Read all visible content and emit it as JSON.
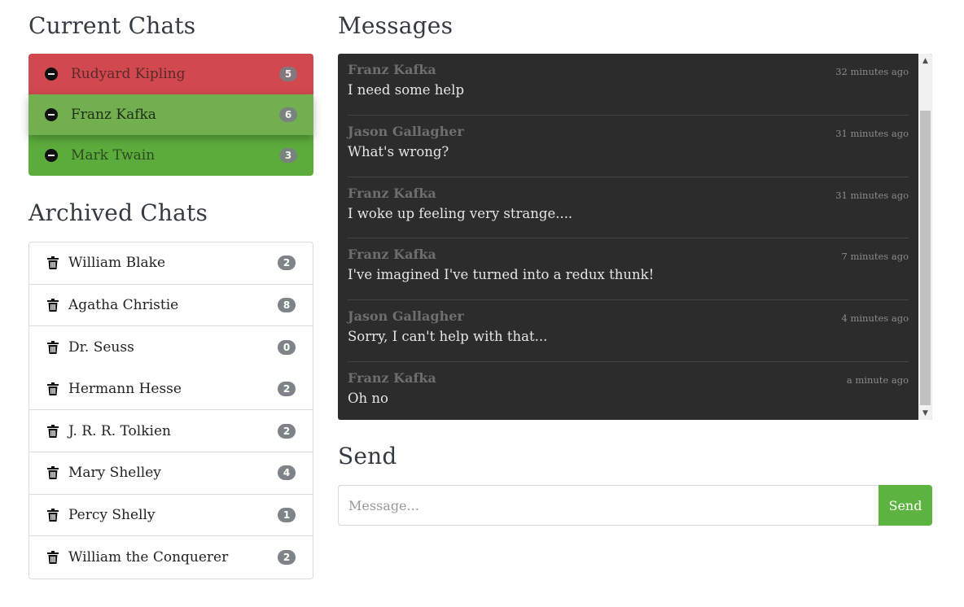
{
  "current_chats": {
    "heading": "Current Chats",
    "items": [
      {
        "name": "Rudyard Kipling",
        "count": "5"
      },
      {
        "name": "Franz Kafka",
        "count": "6"
      },
      {
        "name": "Mark Twain",
        "count": "3"
      }
    ]
  },
  "archived_chats": {
    "heading": "Archived Chats",
    "items": [
      {
        "name": "William Blake",
        "count": "2"
      },
      {
        "name": "Agatha Christie",
        "count": "8"
      },
      {
        "name": "Dr. Seuss",
        "count": "0"
      },
      {
        "name": "Hermann Hesse",
        "count": "2"
      },
      {
        "name": "J. R. R. Tolkien",
        "count": "2"
      },
      {
        "name": "Mary Shelley",
        "count": "4"
      },
      {
        "name": "Percy Shelly",
        "count": "1"
      },
      {
        "name": "William the Conquerer",
        "count": "2"
      }
    ]
  },
  "messages": {
    "heading": "Messages",
    "items": [
      {
        "author": "Franz Kafka",
        "time": "32 minutes ago",
        "text": "I need some help"
      },
      {
        "author": "Jason Gallagher",
        "time": "31 minutes ago",
        "text": "What's wrong?"
      },
      {
        "author": "Franz Kafka",
        "time": "31 minutes ago",
        "text": "I woke up feeling very strange...."
      },
      {
        "author": "Franz Kafka",
        "time": "7 minutes ago",
        "text": "I've imagined I've turned into a redux thunk!"
      },
      {
        "author": "Jason Gallagher",
        "time": "4 minutes ago",
        "text": "Sorry, I can't help with that..."
      },
      {
        "author": "Franz Kafka",
        "time": "a minute ago",
        "text": "Oh no"
      }
    ]
  },
  "send": {
    "heading": "Send",
    "placeholder": "Message...",
    "button_label": "Send"
  },
  "colors": {
    "active_red": "#d1484f",
    "active_green_selected": "#72b04f",
    "active_green": "#5cac3c",
    "send_button": "#5cb340",
    "messages_bg": "#2c2c2c"
  },
  "icons": {
    "current_item": "minus-circle-icon",
    "archived_item": "trash-icon"
  }
}
